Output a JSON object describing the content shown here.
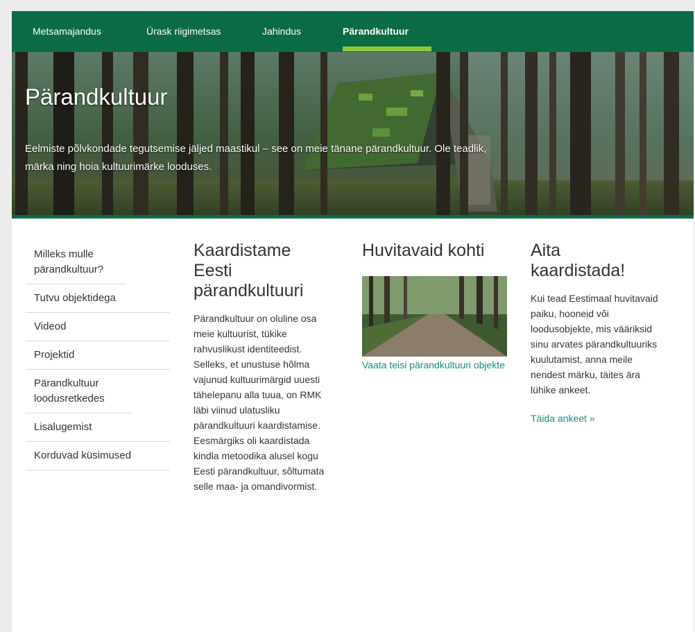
{
  "nav": {
    "items": [
      "Metsamajandus",
      "Ürask riigimetsas",
      "Jahindus",
      "Pärandkultuur"
    ],
    "active": "Pärandkultuur"
  },
  "hero": {
    "title": "Pärandkultuur",
    "text": "Eelmiste põlvkondade tegutsemise jäljed maastikul – see on meie tänane pärandkultuur. Ole teadlik, märka ning hoia kultuurimärke looduses."
  },
  "sidebar": {
    "items": [
      {
        "label": "Milleks mulle pärandkultuur?"
      },
      {
        "label": "Tutvu objektidega"
      },
      {
        "label": "Videod"
      },
      {
        "label": "Projektid"
      },
      {
        "label": "Pärandkultuur loodusretkedes"
      },
      {
        "label": "Lisalugemist"
      },
      {
        "label": "Korduvad küsimused"
      }
    ]
  },
  "col1": {
    "title": "Kaardistame Eesti pärandkultuuri",
    "body": "Pärandkultuur on oluline osa meie kultuurist, tükike rahvuslikust identiteedist. Selleks, et unustuse hõlma vajunud kultuurimärgid uuesti tähelepanu alla tuua, on RMK läbi viinud ulatusliku pärandkultuuri kaardistamise. Eesmärgiks oli kaardistada kindla metoodika alusel kogu Eesti pärandkultuur, sõltumata selle maa- ja omandivormist."
  },
  "col2": {
    "title": "Huvitavaid kohti",
    "link": "Vaata teisi pärandkultuuri objekte"
  },
  "col3": {
    "title": "Aita kaardistada!",
    "body": "Kui tead Eestimaal huvitavaid paiku, hooneid või loodusobjekte, mis vääriksid sinu arvates pärandkultuuriks kuulutamist, anna meile nendest märku, täites ära lühike ankeet.",
    "link": "Täida ankeet »"
  },
  "colors": {
    "brand_green": "#0b6b45",
    "active_underline": "#8cc83c",
    "link_teal": "#128f7a"
  }
}
